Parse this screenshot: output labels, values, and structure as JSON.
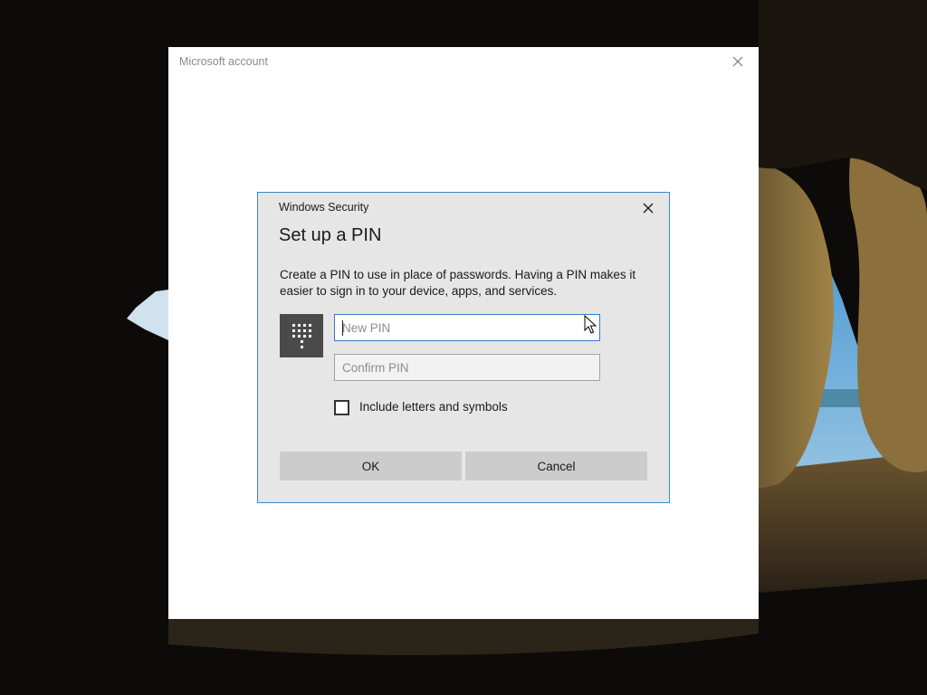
{
  "outer_window": {
    "title": "Microsoft account"
  },
  "dialog": {
    "title": "Windows Security",
    "heading": "Set up a PIN",
    "description": "Create a PIN to use in place of passwords. Having a PIN makes it easier to sign in to your device, apps, and services.",
    "new_pin_placeholder": "New PIN",
    "new_pin_value": "",
    "confirm_pin_placeholder": "Confirm PIN",
    "confirm_pin_value": "",
    "include_checkbox_label": "Include letters and symbols",
    "include_checked": false,
    "ok_label": "OK",
    "cancel_label": "Cancel"
  },
  "icons": {
    "window_close": "close-icon",
    "dialog_close": "close-icon",
    "pin_tile": "keypad-icon",
    "pointer": "mouse-pointer-icon"
  },
  "colors": {
    "dialog_border": "#3f88c5",
    "input_focus_border": "#3b78c4",
    "button_background": "#cccccc",
    "dialog_background": "#e6e6e6",
    "keypad_tile": "#4a4a4a"
  }
}
